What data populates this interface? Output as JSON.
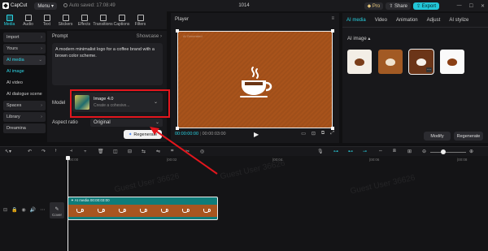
{
  "app": {
    "name": "CapCut",
    "menu_label": "Menu",
    "autosave": "Auto saved: 17:08:49",
    "project_title": "1014",
    "pro_label": "Pro",
    "share_label": "Share",
    "export_label": "Export"
  },
  "toolbar": {
    "tabs": [
      {
        "label": "Media",
        "icon": "media-icon"
      },
      {
        "label": "Audio",
        "icon": "audio-icon"
      },
      {
        "label": "Text",
        "icon": "text-icon"
      },
      {
        "label": "Stickers",
        "icon": "stickers-icon"
      },
      {
        "label": "Effects",
        "icon": "effects-icon"
      },
      {
        "label": "Transitions",
        "icon": "transitions-icon"
      },
      {
        "label": "Captions",
        "icon": "captions-icon"
      },
      {
        "label": "Filters",
        "icon": "filters-icon"
      }
    ]
  },
  "sidebar": {
    "items": [
      {
        "label": "Import"
      },
      {
        "label": "Yours"
      },
      {
        "label": "AI media"
      },
      {
        "label": "AI image"
      },
      {
        "label": "AI video"
      },
      {
        "label": "AI dialogue scene"
      },
      {
        "label": "Spaces"
      },
      {
        "label": "Library"
      },
      {
        "label": "Dreamina"
      }
    ]
  },
  "prompt_panel": {
    "prompt_label": "Prompt",
    "showcase_label": "Showcase",
    "prompt_text": "A modern minimalist logo for a coffee brand with a brown color scheme.",
    "model_label": "Model",
    "model_name": "Image 4.0",
    "model_desc": "Create a cohesive...",
    "aspect_label": "Aspect ratio",
    "aspect_value": "Original",
    "regenerate_label": "Regenerate"
  },
  "player": {
    "title": "Player",
    "time_current": "00:00:00:00",
    "time_total": "00:00:03:00",
    "canvas_watermark": "Ai Generated"
  },
  "ai_panel": {
    "tabs": [
      "AI media",
      "Video",
      "Animation",
      "Adjust",
      "AI stylize"
    ],
    "section_label": "AI image",
    "modify_label": "Modify",
    "regenerate_label": "Regenerate"
  },
  "timeline": {
    "ruler_ticks": [
      "00:00",
      "|00:02",
      "|00:04",
      "|00:06",
      "|00:08",
      "|00:10"
    ],
    "clip_label": "AI media",
    "clip_duration": "00:00:03:00",
    "cover_label": "Cover",
    "watermark": "Guest User 36626"
  },
  "colors": {
    "accent": "#29d3e3",
    "highlight_box": "#e3161d",
    "canvas_brown": "#a8531b"
  }
}
